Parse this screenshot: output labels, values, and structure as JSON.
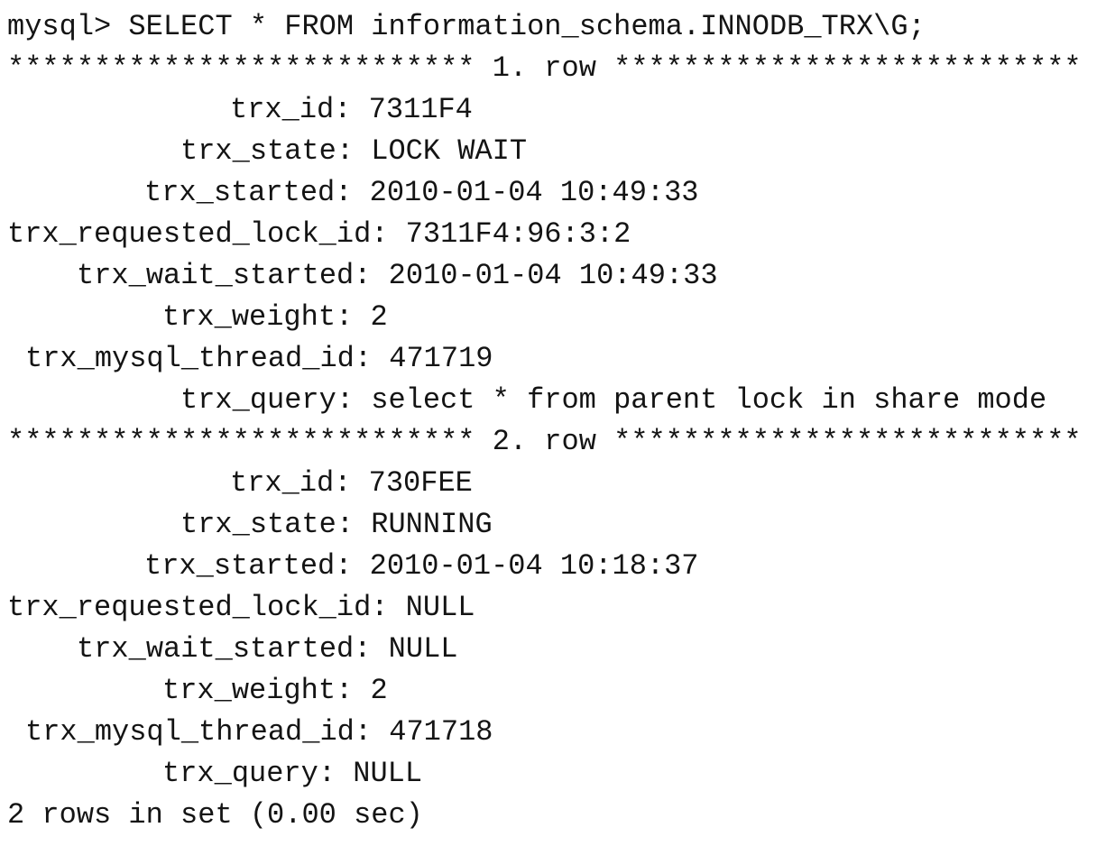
{
  "prompt": "mysql>",
  "command": "SELECT * FROM information_schema.INNODB_TRX\\G;",
  "rows": [
    {
      "header": "*************************** 1. row ***************************",
      "fields": [
        {
          "label": "trx_id:",
          "value": "7311F4"
        },
        {
          "label": "trx_state:",
          "value": "LOCK WAIT"
        },
        {
          "label": "trx_started:",
          "value": "2010-01-04 10:49:33"
        },
        {
          "label": "trx_requested_lock_id:",
          "value": "7311F4:96:3:2"
        },
        {
          "label": "trx_wait_started:",
          "value": "2010-01-04 10:49:33"
        },
        {
          "label": "trx_weight:",
          "value": "2"
        },
        {
          "label": "trx_mysql_thread_id:",
          "value": "471719"
        },
        {
          "label": "trx_query:",
          "value": "select * from parent lock in share mode"
        }
      ]
    },
    {
      "header": "*************************** 2. row ***************************",
      "fields": [
        {
          "label": "trx_id:",
          "value": "730FEE"
        },
        {
          "label": "trx_state:",
          "value": "RUNNING"
        },
        {
          "label": "trx_started:",
          "value": "2010-01-04 10:18:37"
        },
        {
          "label": "trx_requested_lock_id:",
          "value": "NULL"
        },
        {
          "label": "trx_wait_started:",
          "value": "NULL"
        },
        {
          "label": "trx_weight:",
          "value": "2"
        },
        {
          "label": "trx_mysql_thread_id:",
          "value": "471718"
        },
        {
          "label": "trx_query:",
          "value": "NULL"
        }
      ]
    }
  ],
  "summary": "2 rows in set (0.00 sec)"
}
